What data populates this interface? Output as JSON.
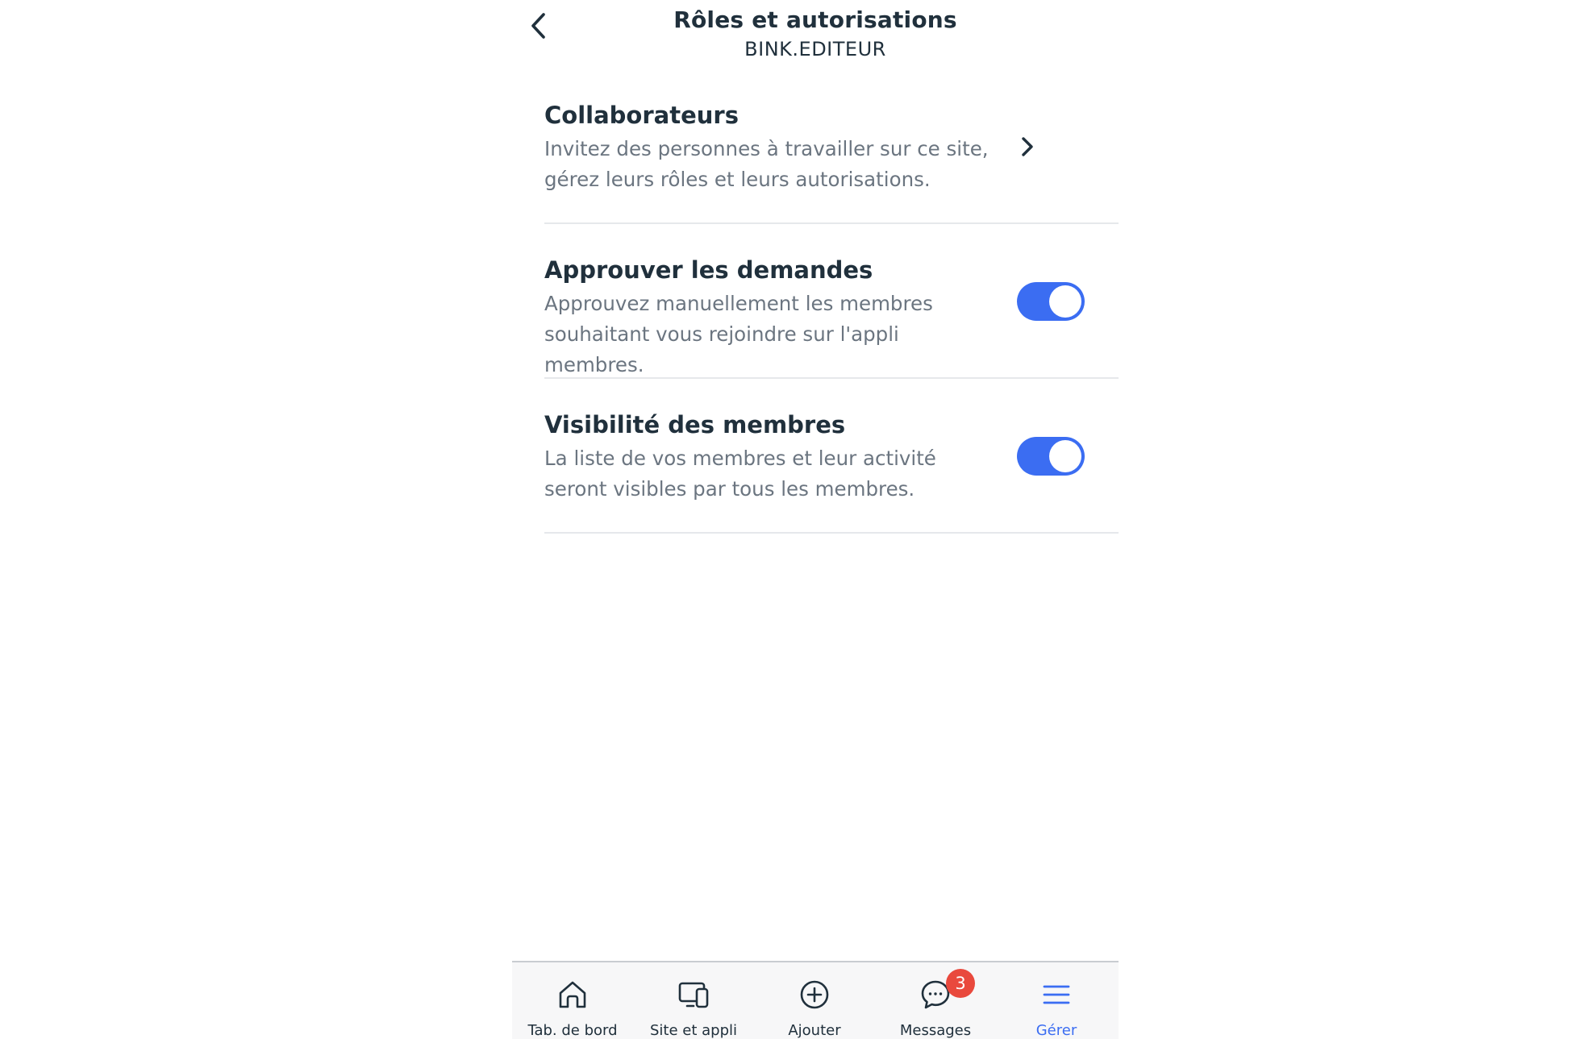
{
  "header": {
    "title": "Rôles et autorisations",
    "subtitle": "BINK.EDITEUR",
    "back_icon": "chevron-left-icon"
  },
  "settings": [
    {
      "title": "Collaborateurs",
      "description": "Invitez des personnes à travailler sur ce site, gérez leurs rôles et leurs autorisations.",
      "control": "chevron-right-icon"
    },
    {
      "title": "Approuver les demandes",
      "description": "Approuvez manuellement les membres souhaitant vous rejoindre sur l'appli membres.",
      "control": "toggle",
      "enabled": true
    },
    {
      "title": "Visibilité des membres",
      "description": "La liste de vos membres et leur activité seront visibles par tous les membres.",
      "control": "toggle",
      "enabled": true
    }
  ],
  "tabbar": {
    "tabs": [
      {
        "label": "Tab. de bord",
        "icon": "home-icon",
        "active": false
      },
      {
        "label": "Site et appli",
        "icon": "devices-icon",
        "active": false
      },
      {
        "label": "Ajouter",
        "icon": "plus-circle-icon",
        "active": false
      },
      {
        "label": "Messages",
        "icon": "chat-bubble-icon",
        "active": false,
        "badge": "3"
      },
      {
        "label": "Gérer",
        "icon": "menu-icon",
        "active": true
      }
    ]
  },
  "colors": {
    "accent": "#3b6df2",
    "text_primary": "#20303c",
    "text_secondary": "#6b7580",
    "badge": "#e9493d",
    "divider": "#e6e8eb"
  }
}
